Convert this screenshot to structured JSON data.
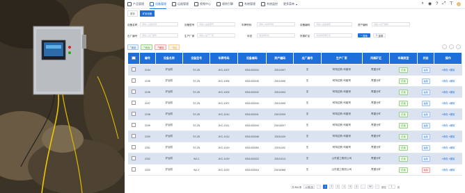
{
  "nav": {
    "items": [
      {
        "label": "产品管理",
        "active": false
      },
      {
        "label": "设备管理",
        "active": true
      },
      {
        "label": "运维管理",
        "active": false
      },
      {
        "label": "视频中心",
        "active": false
      },
      {
        "label": "规则引擎",
        "active": false
      },
      {
        "label": "系统管理",
        "active": false
      },
      {
        "label": "系统监控",
        "active": false
      },
      {
        "label": "更多菜单",
        "active": false
      }
    ]
  },
  "breadcrumb": [
    "首页",
    "矿用设备"
  ],
  "form": {
    "device_name": {
      "label": "设备名称",
      "placeholder": "请输入设备名称"
    },
    "device_model": {
      "label": "设备型号",
      "placeholder": "请输入设备型号"
    },
    "vehicle_no": {
      "label": "车牌号码",
      "placeholder": "请输入车牌号码"
    },
    "device_code": {
      "label": "设备编码",
      "placeholder": "请输入设备编码"
    },
    "asset_code": {
      "label": "资产编码",
      "placeholder": "请输入资产编码"
    },
    "factory_no": {
      "label": "出厂编号",
      "placeholder": "请输入出厂编号"
    },
    "manufacturer": {
      "label": "生产厂家",
      "placeholder": "请输入生产厂家"
    },
    "status": {
      "label": "状态",
      "placeholder": "请选择状态"
    },
    "mine": {
      "label": "所属矿区",
      "placeholder": "请选择所属矿区"
    },
    "search_label": "搜索",
    "reset_label": "重置"
  },
  "toolbar": {
    "add": "新增",
    "edit": "修改",
    "delete": "删除",
    "export": "导出"
  },
  "table": {
    "headers": [
      "编号",
      "设备名称",
      "设备型号",
      "车牌号码",
      "设备编码",
      "资产编码",
      "出厂编号",
      "生产厂家",
      "所属矿区",
      "车辆类型",
      "状态",
      "操作"
    ],
    "rows": [
      [
        "2194",
        "铲运机",
        "ST-2D",
        "JKC-1007",
        "0301020044",
        "Z3011097",
        "无",
        "阿特拉斯·科普柯",
        "青屋分矿",
        "矿用",
        "在用",
        "修改",
        "删除"
      ],
      [
        "2195",
        "铲运机",
        "ST-2D",
        "JKC-1006",
        "0301020045",
        "Z3011096",
        "无",
        "阿特拉斯·科普柯",
        "青屋分矿",
        "矿用",
        "在用",
        "修改",
        "删除"
      ],
      [
        "2196",
        "铲运机",
        "ST-2D",
        "JKC-1005",
        "0301020042",
        "Z3011094",
        "无",
        "阿特拉斯·科普柯",
        "青屋分矿",
        "矿用",
        "在用",
        "修改",
        "删除"
      ],
      [
        "2197",
        "铲运机",
        "ST-2D",
        "JKC-1007",
        "0301020043",
        "Z3011095",
        "无",
        "阿特拉斯·科普柯",
        "青屋分矿",
        "矿用",
        "在用",
        "修改",
        "删除"
      ],
      [
        "2198",
        "铲运机",
        "ST-2D",
        "JKC-1010",
        "0301020041",
        "Z3012009",
        "无",
        "阿特拉斯·科普柯",
        "青屋分矿",
        "矿用",
        "在用",
        "修改",
        "删除"
      ],
      [
        "2199",
        "铲运机",
        "ST-2D",
        "JKC-1011",
        "0301020044",
        "Z3010007",
        "无",
        "阿特拉斯·科普柯",
        "青屋分矿",
        "矿用",
        "在用",
        "修改",
        "删除"
      ],
      [
        "2200",
        "铲运机",
        "ST-2D",
        "JKC-1012",
        "0301020048",
        "Z3011109",
        "无",
        "阿特拉斯·科普柯",
        "青屋分矿",
        "矿用",
        "在用",
        "修改",
        "删除"
      ],
      [
        "2201",
        "铲运机",
        "ST-2D",
        "JKC-1019",
        "0301020050",
        "Z3011102",
        "无",
        "阿特拉斯·科普柯",
        "青屋分矿",
        "矿用",
        "在用",
        "修改",
        "删除"
      ],
      [
        "2202",
        "铲运机",
        "WJ-2",
        "JKC-1019",
        "0301020023",
        "Z3011013",
        "无",
        "山东嘉工程机公司",
        "青屋分矿",
        "矿用",
        "在用",
        "修改",
        "删除"
      ],
      [
        "2203",
        "铲运机",
        "WJ-2",
        "JKC-1022",
        "0301020016",
        "Z3010968",
        "无",
        "山东嘉工程机公司",
        "青屋分矿",
        "矿用",
        "停用",
        "修改",
        "删除"
      ]
    ]
  },
  "pager": {
    "total": "共 866 条",
    "page_size": "10条/页",
    "pages": [
      "1",
      "2",
      "3",
      "4",
      "5",
      "6",
      "...",
      "90"
    ],
    "goto_label": "前往",
    "goto_value": "1",
    "page_suffix": "页"
  },
  "colors": {
    "primary": "#1e6fd9",
    "row_alt": "#dbe3f1"
  }
}
